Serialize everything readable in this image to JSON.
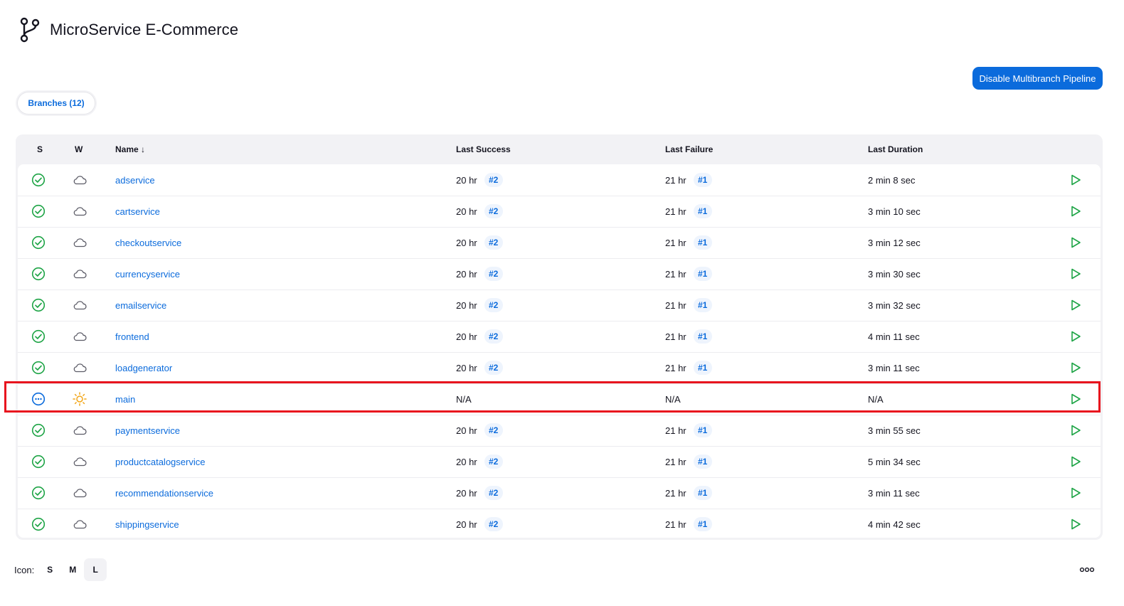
{
  "page": {
    "title": "MicroService E-Commerce"
  },
  "actions": {
    "disable_label": "Disable Multibranch Pipeline"
  },
  "tabs": [
    {
      "label": "Branches (12)",
      "active": true
    }
  ],
  "table": {
    "headers": {
      "s": "S",
      "w": "W",
      "name": "Name ↓",
      "last_success": "Last Success",
      "last_failure": "Last Failure",
      "last_duration": "Last Duration"
    },
    "rows": [
      {
        "name": "adservice",
        "status": "success",
        "weather": "cloudy",
        "success_time": "20 hr",
        "success_build": "#2",
        "failure_time": "21 hr",
        "failure_build": "#1",
        "duration": "2 min 8 sec"
      },
      {
        "name": "cartservice",
        "status": "success",
        "weather": "cloudy",
        "success_time": "20 hr",
        "success_build": "#2",
        "failure_time": "21 hr",
        "failure_build": "#1",
        "duration": "3 min 10 sec"
      },
      {
        "name": "checkoutservice",
        "status": "success",
        "weather": "cloudy",
        "success_time": "20 hr",
        "success_build": "#2",
        "failure_time": "21 hr",
        "failure_build": "#1",
        "duration": "3 min 12 sec"
      },
      {
        "name": "currencyservice",
        "status": "success",
        "weather": "cloudy",
        "success_time": "20 hr",
        "success_build": "#2",
        "failure_time": "21 hr",
        "failure_build": "#1",
        "duration": "3 min 30 sec"
      },
      {
        "name": "emailservice",
        "status": "success",
        "weather": "cloudy",
        "success_time": "20 hr",
        "success_build": "#2",
        "failure_time": "21 hr",
        "failure_build": "#1",
        "duration": "3 min 32 sec"
      },
      {
        "name": "frontend",
        "status": "success",
        "weather": "cloudy",
        "success_time": "20 hr",
        "success_build": "#2",
        "failure_time": "21 hr",
        "failure_build": "#1",
        "duration": "4 min 11 sec"
      },
      {
        "name": "loadgenerator",
        "status": "success",
        "weather": "cloudy",
        "success_time": "20 hr",
        "success_build": "#2",
        "failure_time": "21 hr",
        "failure_build": "#1",
        "duration": "3 min 11 sec"
      },
      {
        "name": "main",
        "status": "not-built",
        "weather": "sunny",
        "success_time": "N/A",
        "success_build": "",
        "failure_time": "N/A",
        "failure_build": "",
        "duration": "N/A",
        "highlighted": true
      },
      {
        "name": "paymentservice",
        "status": "success",
        "weather": "cloudy",
        "success_time": "20 hr",
        "success_build": "#2",
        "failure_time": "21 hr",
        "failure_build": "#1",
        "duration": "3 min 55 sec"
      },
      {
        "name": "productcatalogservice",
        "status": "success",
        "weather": "cloudy",
        "success_time": "20 hr",
        "success_build": "#2",
        "failure_time": "21 hr",
        "failure_build": "#1",
        "duration": "5 min 34 sec"
      },
      {
        "name": "recommendationservice",
        "status": "success",
        "weather": "cloudy",
        "success_time": "20 hr",
        "success_build": "#2",
        "failure_time": "21 hr",
        "failure_build": "#1",
        "duration": "3 min 11 sec"
      },
      {
        "name": "shippingservice",
        "status": "success",
        "weather": "cloudy",
        "success_time": "20 hr",
        "success_build": "#2",
        "failure_time": "21 hr",
        "failure_build": "#1",
        "duration": "4 min 42 sec"
      }
    ]
  },
  "footer": {
    "icon_label": "Icon:",
    "sizes": [
      "S",
      "M",
      "L"
    ],
    "active_size": "L"
  },
  "colors": {
    "accent": "#0b6bdc",
    "success": "#1ea446",
    "in_progress": "#0b6bdc",
    "sunny": "#f2a516",
    "cloud": "#5b5b66",
    "highlight": "#e8141e"
  }
}
